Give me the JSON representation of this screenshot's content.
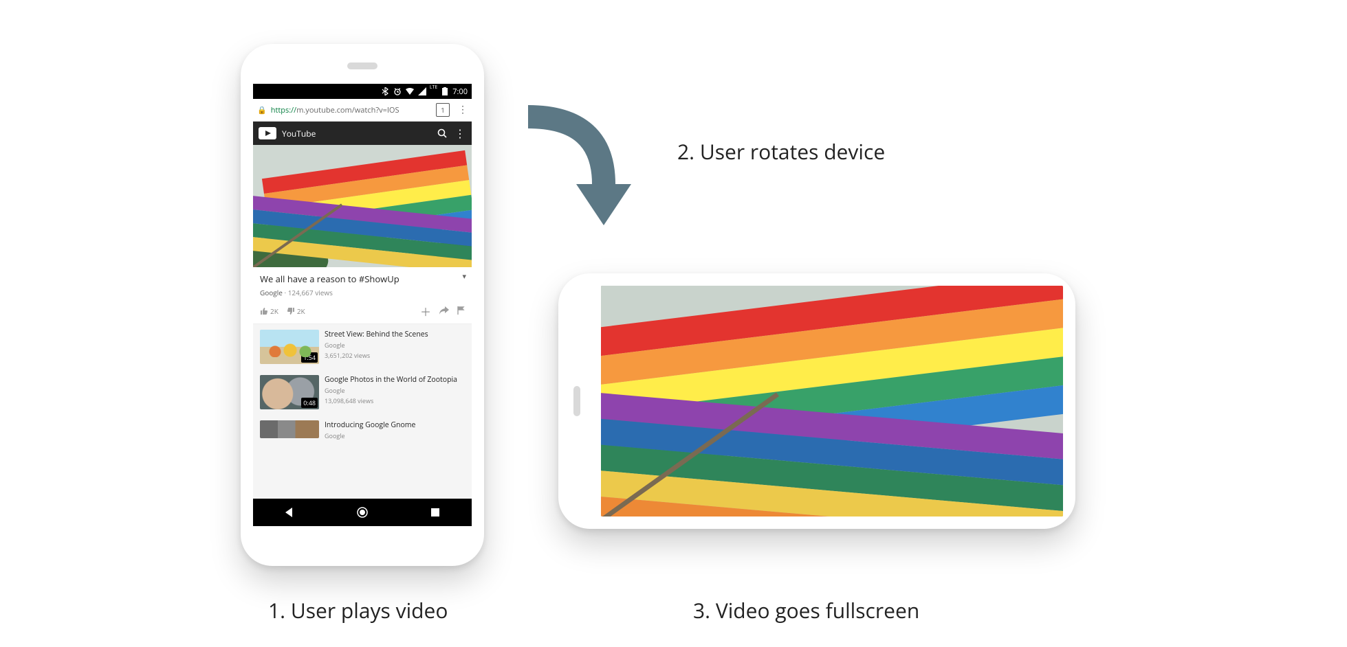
{
  "captions": {
    "step1": "1. User plays video",
    "step2": "2. User rotates device",
    "step3": "3. Video goes fullscreen"
  },
  "statusbar": {
    "time": "7:00",
    "lte": "LTE"
  },
  "urlbar": {
    "protocol": "https://",
    "rest": "m.youtube.com/watch?v=IOS",
    "tab_count": "1"
  },
  "yt_header": {
    "brand": "YouTube"
  },
  "video": {
    "title": "We all have a reason to #ShowUp",
    "channel": "Google",
    "views": "124,667 views",
    "likes": "2K",
    "dislikes": "2K"
  },
  "recs": [
    {
      "title": "Street View: Behind the Scenes",
      "channel": "Google",
      "views": "3,651,202 views",
      "duration": "1:54"
    },
    {
      "title": "Google Photos in the World of Zootopia",
      "channel": "Google",
      "views": "13,098,648 views",
      "duration": "0:48"
    },
    {
      "title": "Introducing Google Gnome",
      "channel": "Google",
      "views": "",
      "duration": ""
    }
  ]
}
